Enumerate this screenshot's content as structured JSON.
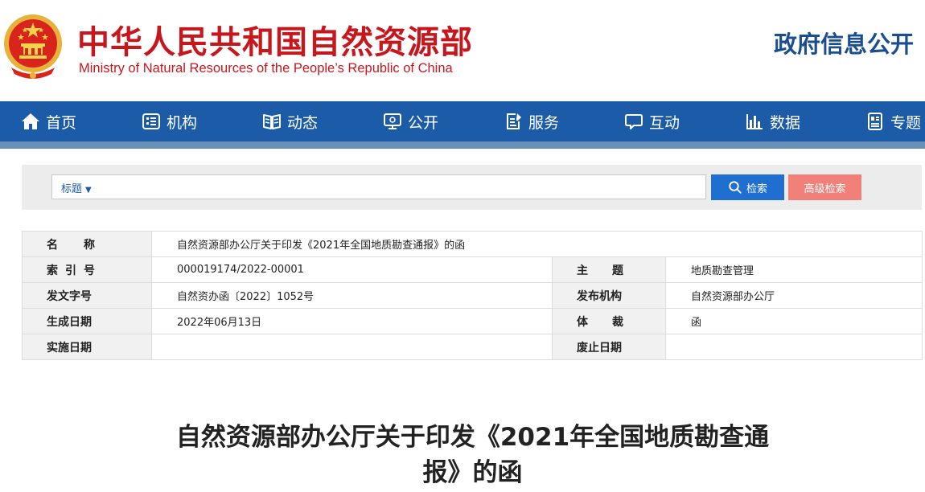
{
  "header": {
    "title_cn": "中华人民共和国自然资源部",
    "title_en": "Ministry of Natural Resources of the People’s Republic of China",
    "gov_info": "政府信息公开",
    "emblem_icon": "national-emblem-icon"
  },
  "nav": {
    "items": [
      {
        "label": "首页",
        "icon": "home-icon"
      },
      {
        "label": "机构",
        "icon": "organization-icon"
      },
      {
        "label": "动态",
        "icon": "book-icon"
      },
      {
        "label": "公开",
        "icon": "monitor-icon"
      },
      {
        "label": "服务",
        "icon": "document-edit-icon"
      },
      {
        "label": "互动",
        "icon": "chat-icon"
      },
      {
        "label": "数据",
        "icon": "bar-chart-icon"
      },
      {
        "label": "专题",
        "icon": "topic-icon"
      }
    ]
  },
  "search": {
    "type_label": "标题",
    "value": "",
    "search_label": "检索",
    "advanced_label": "高级检索"
  },
  "info": {
    "name_label": "名称",
    "name_value": "自然资源部办公厅关于印发《2021年全国地质勘查通报》的函",
    "index_label": "索引号",
    "index_value": "000019174/2022-00001",
    "subject_label": "主题",
    "subject_value": "地质勘查管理",
    "doc_no_label": "发文字号",
    "doc_no_value": "自然资办函〔2022〕1052号",
    "publisher_label": "发布机构",
    "publisher_value": "自然资源部办公厅",
    "created_label": "生成日期",
    "created_value": "2022年06月13日",
    "genre_label": "体裁",
    "genre_value": "函",
    "effective_label": "实施日期",
    "effective_value": "",
    "abolished_label": "废止日期",
    "abolished_value": ""
  },
  "document": {
    "title_line1": "自然资源部办公厅关于印发《2021年全国地质勘查通",
    "title_line2": "报》的函"
  },
  "colors": {
    "brand_red": "#c8161d",
    "nav_blue": "#1c5ba8",
    "search_blue": "#1e6fd0",
    "advanced_pink": "#f08078"
  }
}
